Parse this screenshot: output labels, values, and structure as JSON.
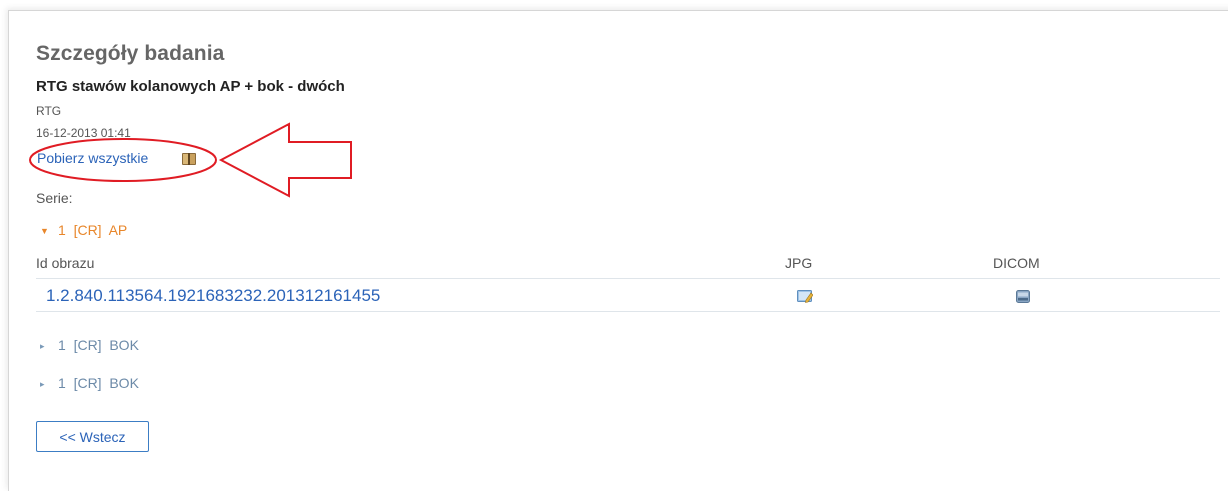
{
  "details": {
    "title": "Szczegóły badania",
    "exam_name": "RTG stawów kolanowych AP + bok - dwóch",
    "modality": "RTG",
    "date": "16-12-2013 01:41",
    "download_all_label": "Pobierz wszystkie",
    "download_icon": "book-icon"
  },
  "series": {
    "label": "Serie:",
    "items": [
      {
        "label": "1  [CR]  AP",
        "expanded": true
      },
      {
        "label": "1  [CR]  BOK",
        "expanded": false
      },
      {
        "label": "1  [CR]  BOK",
        "expanded": false
      }
    ],
    "table": {
      "columns": [
        "Id obrazu",
        "JPG",
        "DICOM"
      ],
      "rows": [
        {
          "id": "1.2.840.113564.1921683232.201312161455",
          "jpg_icon": "image-edit-icon",
          "dicom_icon": "dicom-file-icon"
        }
      ]
    }
  },
  "back_button_label": "<< Wstecz",
  "colors": {
    "link": "#2b63b8",
    "expanded_series": "#e8862a",
    "collapsed_series": "#6c8aa8",
    "annotation": "#e01c24"
  }
}
